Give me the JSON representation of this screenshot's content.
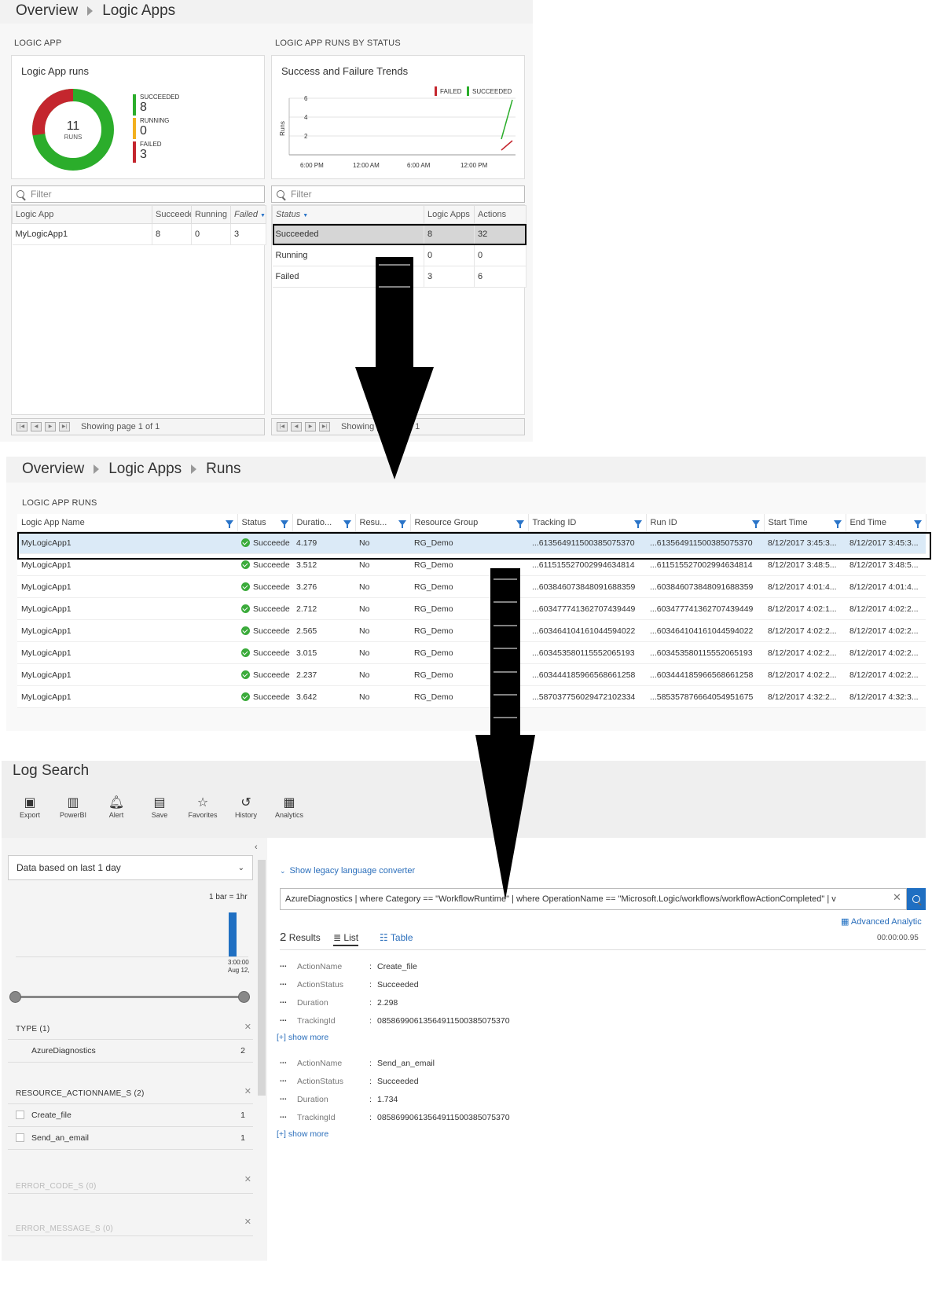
{
  "p1": {
    "breadcrumb": [
      "Overview",
      "Logic Apps"
    ],
    "section_left": "LOGIC APP",
    "section_right": "LOGIC APP RUNS BY STATUS",
    "runs_card": {
      "title": "Logic App runs",
      "total": "11",
      "total_label": "RUNS",
      "legend": [
        {
          "label": "SUCCEEDED",
          "value": "8",
          "color": "#2bad2b"
        },
        {
          "label": "RUNNING",
          "value": "0",
          "color": "#f2b01e"
        },
        {
          "label": "FAILED",
          "value": "3",
          "color": "#c4262e"
        }
      ]
    },
    "trend_card": {
      "title": "Success and Failure Trends",
      "legend_failed": "FAILED",
      "legend_succeeded": "SUCCEEDED",
      "ylabel": "Runs",
      "yticks": [
        "6",
        "4",
        "2"
      ],
      "xticks": [
        "6:00 PM",
        "12:00 AM",
        "6:00 AM",
        "12:00 PM"
      ]
    },
    "filter_placeholder": "Filter",
    "left_grid": {
      "headers": [
        "Logic App",
        "Succeede",
        "Running",
        "Failed"
      ],
      "rows": [
        [
          "MyLogicApp1",
          "8",
          "0",
          "3"
        ]
      ]
    },
    "right_grid": {
      "headers": [
        "Status",
        "Logic Apps",
        "Actions"
      ],
      "rows": [
        [
          "Succeeded",
          "8",
          "32"
        ],
        [
          "Running",
          "0",
          "0"
        ],
        [
          "Failed",
          "3",
          "6"
        ]
      ]
    },
    "pager_left": "Showing page 1 of 1",
    "pager_right": "Showing page 1 of 1"
  },
  "p2": {
    "breadcrumb": [
      "Overview",
      "Logic Apps",
      "Runs"
    ],
    "section": "LOGIC APP RUNS",
    "headers": [
      "Logic App Name",
      "Status",
      "Duratio...",
      "Resu...",
      "Resource Group",
      "Tracking ID",
      "Run ID",
      "Start Time",
      "End Time"
    ],
    "rows": [
      [
        "MyLogicApp1",
        "Succeede",
        "4.179",
        "No",
        "RG_Demo",
        "...613564911500385075370",
        "...613564911500385075370",
        "8/12/2017 3:45:3...",
        "8/12/2017 3:45:3..."
      ],
      [
        "MyLogicApp1",
        "Succeede",
        "3.512",
        "No",
        "RG_Demo",
        "...611515527002994634814",
        "...611515527002994634814",
        "8/12/2017 3:48:5...",
        "8/12/2017 3:48:5..."
      ],
      [
        "MyLogicApp1",
        "Succeede",
        "3.276",
        "No",
        "RG_Demo",
        "...603846073848091688359",
        "...603846073848091688359",
        "8/12/2017 4:01:4...",
        "8/12/2017 4:01:4..."
      ],
      [
        "MyLogicApp1",
        "Succeede",
        "2.712",
        "No",
        "RG_Demo",
        "...603477741362707439449",
        "...603477741362707439449",
        "8/12/2017 4:02:1...",
        "8/12/2017 4:02:2..."
      ],
      [
        "MyLogicApp1",
        "Succeede",
        "2.565",
        "No",
        "RG_Demo",
        "...603464104161044594022",
        "...603464104161044594022",
        "8/12/2017 4:02:2...",
        "8/12/2017 4:02:2..."
      ],
      [
        "MyLogicApp1",
        "Succeede",
        "3.015",
        "No",
        "RG_Demo",
        "...603453580115552065193",
        "...603453580115552065193",
        "8/12/2017 4:02:2...",
        "8/12/2017 4:02:2..."
      ],
      [
        "MyLogicApp1",
        "Succeede",
        "2.237",
        "No",
        "RG_Demo",
        "...603444185966568661258",
        "...603444185966568661258",
        "8/12/2017 4:02:2...",
        "8/12/2017 4:02:2..."
      ],
      [
        "MyLogicApp1",
        "Succeede",
        "3.642",
        "No",
        "RG_Demo",
        "...587037756029472102334",
        "...585357876664054951675",
        "8/12/2017 4:32:2...",
        "8/12/2017 4:32:3..."
      ]
    ]
  },
  "p3": {
    "title": "Log Search",
    "toolbar": [
      {
        "label": "Export",
        "icon": "excel-icon"
      },
      {
        "label": "PowerBI",
        "icon": "powerbi-icon"
      },
      {
        "label": "Alert",
        "icon": "bell-icon"
      },
      {
        "label": "Save",
        "icon": "save-icon"
      },
      {
        "label": "Favorites",
        "icon": "star-icon"
      },
      {
        "label": "History",
        "icon": "history-icon"
      },
      {
        "label": "Analytics",
        "icon": "analytics-icon"
      }
    ],
    "time_select": "Data based on last 1 day",
    "bar_scale": "1 bar = 1hr",
    "histogram_tick_time": "3:00:00",
    "histogram_tick_date": "Aug 12,",
    "facets": [
      {
        "title": "TYPE  (1)",
        "items": [
          {
            "label": "AzureDiagnostics",
            "count": "2"
          }
        ]
      },
      {
        "title": "RESOURCE_ACTIONNAME_S  (2)",
        "items": [
          {
            "label": "Create_file",
            "count": "1"
          },
          {
            "label": "Send_an_email",
            "count": "1"
          }
        ]
      },
      {
        "title": "ERROR_CODE_S  (0)",
        "items": []
      },
      {
        "title": "ERROR_MESSAGE_S  (0)",
        "items": []
      }
    ],
    "legacy_link": "Show legacy language converter",
    "query": "AzureDiagnostics | where Category == \"WorkflowRuntime\" | where OperationName == \"Microsoft.Logic/workflows/workflowActionCompleted\" | v",
    "advanced": "Advanced Analytic",
    "results_count": "2",
    "results_label": "Results",
    "tab_list": "List",
    "tab_table": "Table",
    "elapsed": "00:00:00.95",
    "results": [
      {
        "fields": [
          {
            "key": "ActionName",
            "value": "Create_file"
          },
          {
            "key": "ActionStatus",
            "value": "Succeeded"
          },
          {
            "key": "Duration",
            "value": "2.298"
          },
          {
            "key": "TrackingId",
            "value": "08586990613564911500385075370"
          }
        ]
      },
      {
        "fields": [
          {
            "key": "ActionName",
            "value": "Send_an_email"
          },
          {
            "key": "ActionStatus",
            "value": "Succeeded"
          },
          {
            "key": "Duration",
            "value": "1.734"
          },
          {
            "key": "TrackingId",
            "value": "08586990613564911500385075370"
          }
        ]
      }
    ],
    "show_more": "[+] show more"
  }
}
